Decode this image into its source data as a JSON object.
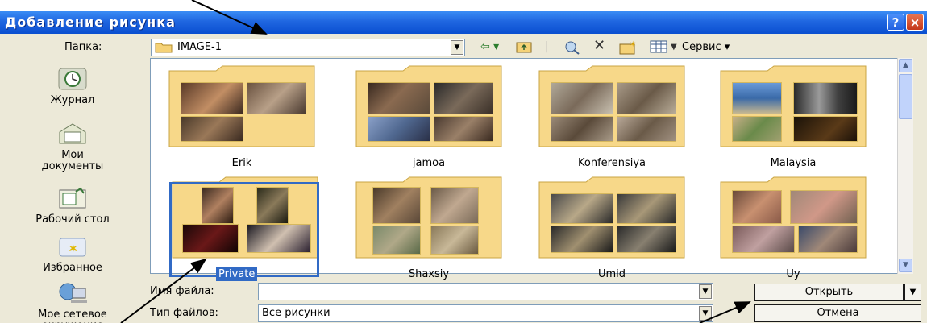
{
  "window": {
    "title": "Добавление рисунка",
    "help_label": "?",
    "close_label": "×"
  },
  "toolbar": {
    "folder_label": "Папка:",
    "current_folder": "IMAGE-1",
    "service_label": "Сервис ▾"
  },
  "places": [
    "Журнал",
    "Мои документы",
    "Рабочий стол",
    "Избранное",
    "Мое сетевое окружение"
  ],
  "folders": [
    {
      "name": "Erik"
    },
    {
      "name": "jamoa"
    },
    {
      "name": "Konferensiya"
    },
    {
      "name": "Malaysia"
    },
    {
      "name": "Private",
      "selected": true
    },
    {
      "name": "Shaxsiy"
    },
    {
      "name": "Umid"
    },
    {
      "name": "Uy"
    }
  ],
  "fields": {
    "file_name_label": "Имя файла:",
    "file_name_value": "",
    "file_type_label": "Тип файлов:",
    "file_type_value": "Все рисунки"
  },
  "buttons": {
    "open": "Открыть",
    "cancel": "Отмена"
  },
  "colors": {
    "titlebar": "#0a4fd0",
    "selection": "#316ac5",
    "dialog_bg": "#ece9d8",
    "folder": "#f5d277"
  }
}
